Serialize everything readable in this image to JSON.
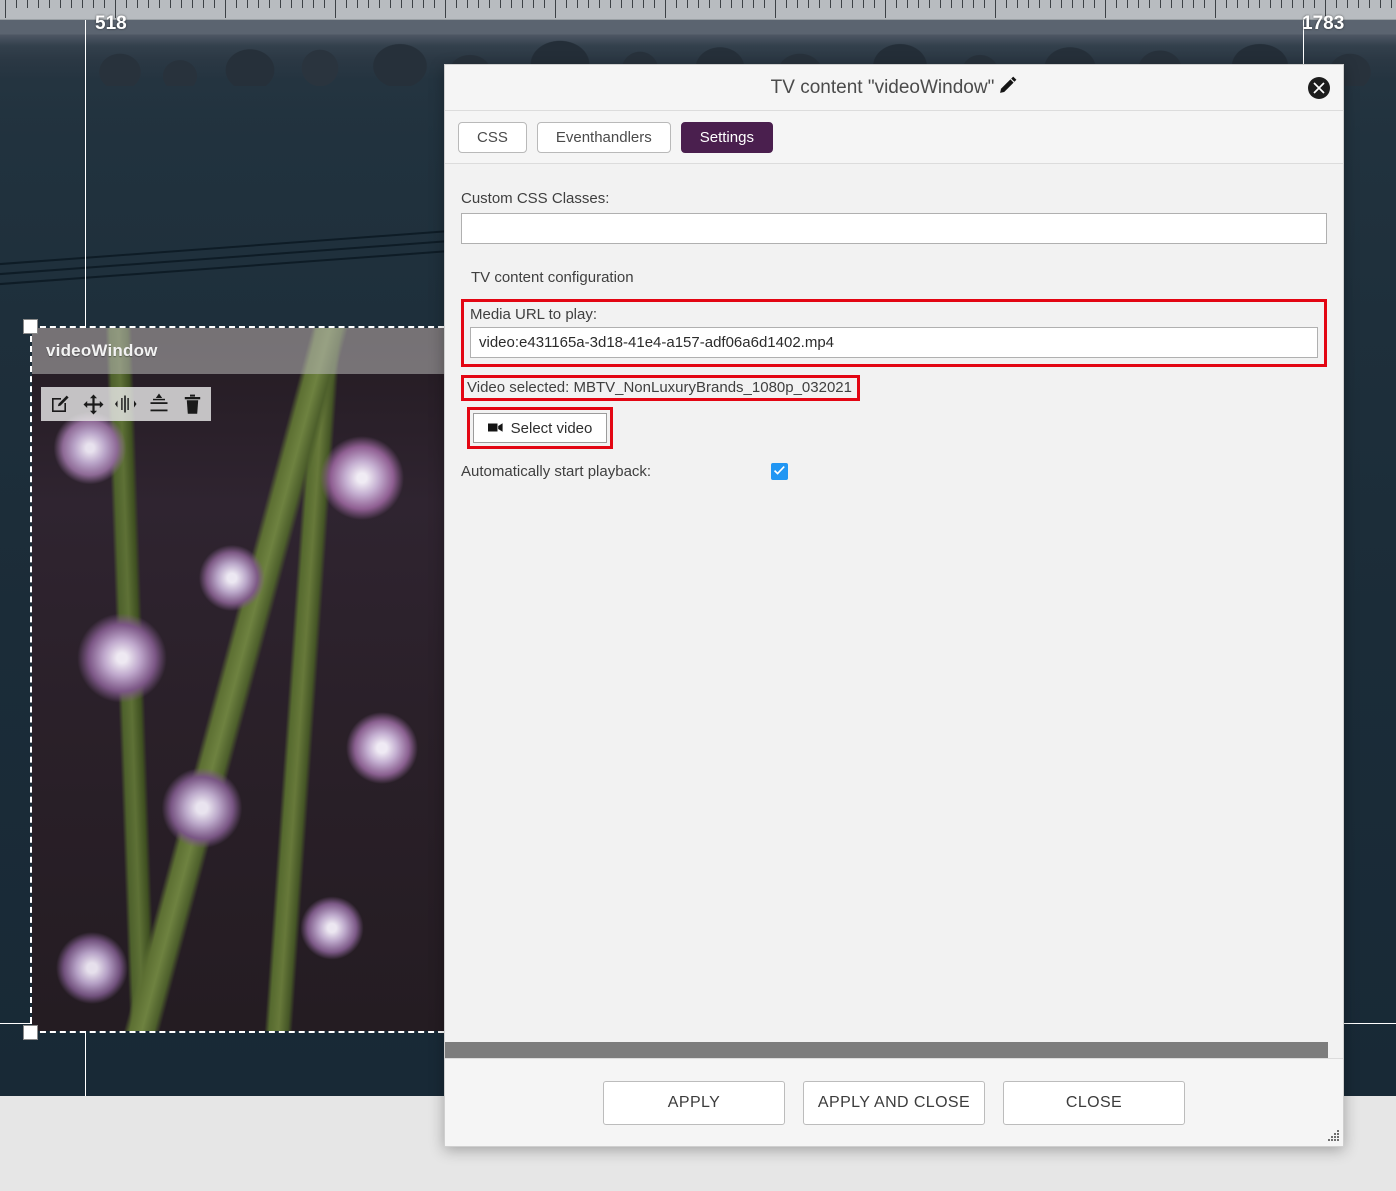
{
  "ruler": {
    "left_marker": "518",
    "right_marker": "1783"
  },
  "canvas": {
    "selected_element": {
      "name": "videoWindow",
      "toolbar": [
        {
          "icon": "edit-icon",
          "label": "Edit"
        },
        {
          "icon": "move-icon",
          "label": "Move"
        },
        {
          "icon": "align-horizontal-center-icon",
          "label": "Align horizontal center"
        },
        {
          "icon": "align-vertical-center-icon",
          "label": "Align vertical center"
        },
        {
          "icon": "trash-icon",
          "label": "Delete"
        }
      ]
    }
  },
  "dialog": {
    "title": "TV content \"videoWindow\"",
    "title_edit_icon": "pencil-icon",
    "close_icon": "close-circle-icon",
    "tabs": [
      {
        "label": "CSS",
        "active": false
      },
      {
        "label": "Eventhandlers",
        "active": false
      },
      {
        "label": "Settings",
        "active": true
      }
    ],
    "settings": {
      "custom_css_label": "Custom CSS Classes:",
      "custom_css_value": "",
      "custom_css_placeholder": "",
      "section_title": "TV content configuration",
      "media_url_label": "Media URL to play:",
      "media_url_value": "video:e431165a-3d18-41e4-a157-adf06a6d1402.mp4",
      "video_selected_text": "Video selected: MBTV_NonLuxuryBrands_1080p_032021",
      "select_video_button": "Select video",
      "select_video_icon": "video-camera-icon",
      "autoplay_label": "Automatically start playback:",
      "autoplay_checked": true
    },
    "footer": {
      "apply": "APPLY",
      "apply_and_close": "APPLY AND CLOSE",
      "close": "CLOSE"
    },
    "accent_color": "#4a1f4e",
    "highlight_color": "#e30613",
    "checkbox_color": "#2196f3"
  }
}
